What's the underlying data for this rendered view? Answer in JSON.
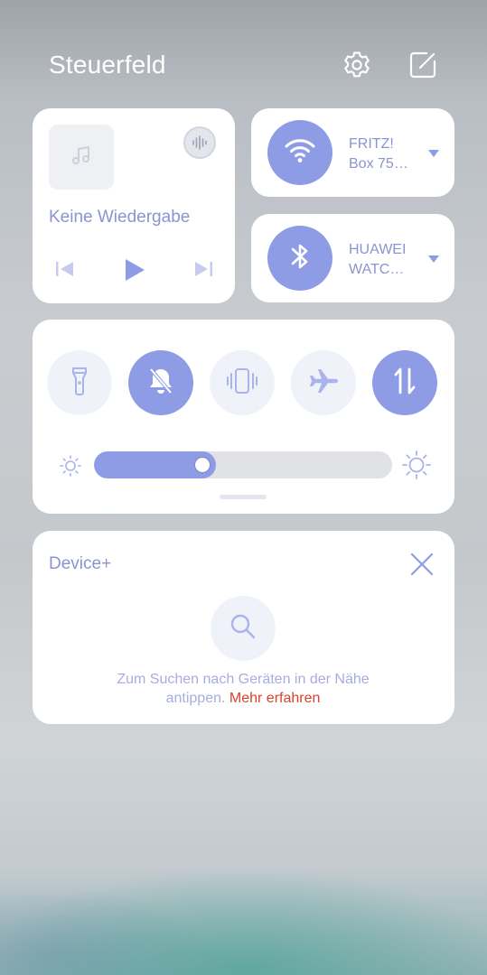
{
  "header": {
    "title": "Steuerfeld",
    "settings_icon": "gear-icon",
    "edit_icon": "edit-icon"
  },
  "media": {
    "status_text": "Keine Wiedergabe",
    "art_icon": "music-note-icon",
    "audio_output_icon": "audio-waveform-icon",
    "controls": [
      "previous-icon",
      "play-icon",
      "next-icon"
    ]
  },
  "wifi": {
    "network_line1": "FRITZ!",
    "network_line2": "Box 75…",
    "icon": "wifi-icon"
  },
  "bluetooth": {
    "device_line1": "HUAWEI",
    "device_line2": "WATC…",
    "icon": "bluetooth-icon"
  },
  "toggles": [
    {
      "name": "flashlight",
      "icon": "flashlight-icon",
      "active": false
    },
    {
      "name": "silent",
      "icon": "bell-off-icon",
      "active": true
    },
    {
      "name": "vibration",
      "icon": "vibrate-icon",
      "active": false
    },
    {
      "name": "airplane",
      "icon": "airplane-icon",
      "active": false
    },
    {
      "name": "mobile-data",
      "icon": "mobile-data-icon",
      "active": true
    }
  ],
  "brightness": {
    "level_percent": 41
  },
  "device_plus": {
    "title": "Device+",
    "hint_text": "Zum Suchen nach Geräten in der Nähe",
    "hint_text2": "antippen.",
    "link_text": "Mehr erfahren"
  },
  "colors": {
    "accent": "#8e9ce6",
    "accent_text": "#8b94d0",
    "link": "#d9432c"
  }
}
